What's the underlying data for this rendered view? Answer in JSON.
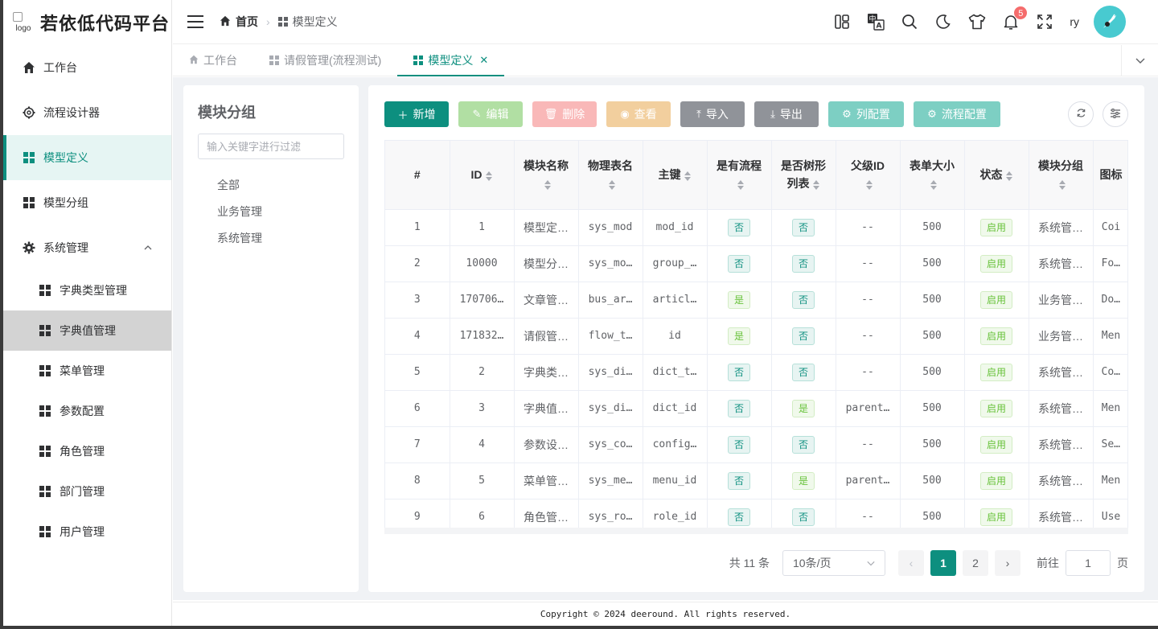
{
  "app": {
    "logo_alt": "logo",
    "title": "若依低代码平台"
  },
  "sidebar": {
    "items": [
      {
        "label": "工作台",
        "icon": "home-icon"
      },
      {
        "label": "流程设计器",
        "icon": "gear-outline-icon"
      },
      {
        "label": "模型定义",
        "icon": "grid-icon",
        "active": true
      },
      {
        "label": "模型分组",
        "icon": "grid-icon"
      },
      {
        "label": "系统管理",
        "icon": "gear-icon",
        "expanded": true
      }
    ],
    "sub_items": [
      {
        "label": "字典类型管理"
      },
      {
        "label": "字典值管理",
        "hover": true
      },
      {
        "label": "菜单管理"
      },
      {
        "label": "参数配置"
      },
      {
        "label": "角色管理"
      },
      {
        "label": "部门管理"
      },
      {
        "label": "用户管理"
      }
    ]
  },
  "header": {
    "breadcrumb": {
      "home": "首页",
      "current": "模型定义"
    },
    "notification_count": "5",
    "user_name": "ry"
  },
  "tabs": [
    {
      "label": "工作台"
    },
    {
      "label": "请假管理(流程测试)"
    },
    {
      "label": "模型定义",
      "active": true
    }
  ],
  "left_panel": {
    "title": "模块分组",
    "filter_placeholder": "输入关键字进行过滤",
    "tree": [
      "全部",
      "业务管理",
      "系统管理"
    ]
  },
  "toolbar": {
    "add": "新增",
    "edit": "编辑",
    "delete": "删除",
    "view": "查看",
    "import": "导入",
    "export": "导出",
    "columns": "列配置",
    "flow": "流程配置"
  },
  "table": {
    "headers": [
      "#",
      "ID",
      "模块名称",
      "物理表名",
      "主键",
      "是有流程",
      "是否树形列表",
      "父级ID",
      "表单大小",
      "状态",
      "模块分组",
      "图标"
    ],
    "rows": [
      [
        "1",
        "1",
        "模型定…",
        "sys_mod",
        "mod_id",
        "否",
        "否",
        "--",
        "500",
        "启用",
        "系统管…",
        "Coi"
      ],
      [
        "2",
        "10000",
        "模型分…",
        "sys_mo…",
        "group_…",
        "否",
        "否",
        "--",
        "500",
        "启用",
        "系统管…",
        "Fold"
      ],
      [
        "3",
        "170706…",
        "文章管…",
        "bus_ar…",
        "articl…",
        "是",
        "否",
        "--",
        "500",
        "启用",
        "业务管…",
        "Docu"
      ],
      [
        "4",
        "171832…",
        "请假管…",
        "flow_t…",
        "id",
        "是",
        "否",
        "--",
        "500",
        "启用",
        "业务管…",
        "Men"
      ],
      [
        "5",
        "2",
        "字典类…",
        "sys_di…",
        "dict_t…",
        "否",
        "否",
        "--",
        "500",
        "启用",
        "系统管…",
        "Colle"
      ],
      [
        "6",
        "3",
        "字典值…",
        "sys_di…",
        "dict_id",
        "否",
        "是",
        "parent…",
        "500",
        "启用",
        "系统管…",
        "Men"
      ],
      [
        "7",
        "4",
        "参数设…",
        "sys_co…",
        "config…",
        "否",
        "否",
        "--",
        "500",
        "启用",
        "系统管…",
        "Sett"
      ],
      [
        "8",
        "5",
        "菜单管…",
        "sys_me…",
        "menu_id",
        "否",
        "是",
        "parent…",
        "500",
        "启用",
        "系统管…",
        "Men"
      ],
      [
        "9",
        "6",
        "角色管…",
        "sys_ro…",
        "role_id",
        "否",
        "否",
        "--",
        "500",
        "启用",
        "系统管…",
        "Use"
      ]
    ]
  },
  "pagination": {
    "total": "共 11 条",
    "page_size": "10条/页",
    "pages": [
      "1",
      "2"
    ],
    "current": "1",
    "goto_label": "前往",
    "goto_value": "1",
    "page_suffix": "页"
  },
  "footer": {
    "copyright": "Copyright © 2024 deeround. All rights reserved."
  },
  "colors": {
    "primary": "#0d8f7f",
    "danger": "#f56c6c",
    "success": "#67c23a"
  }
}
